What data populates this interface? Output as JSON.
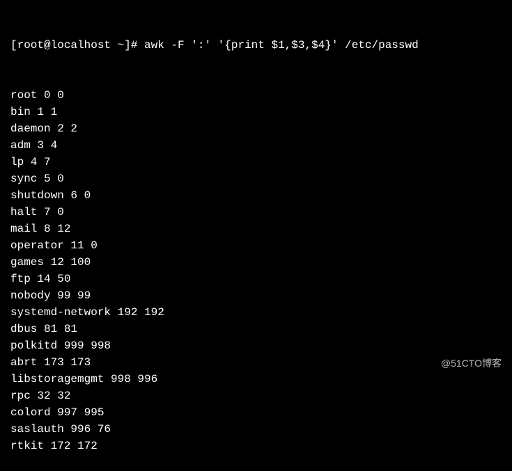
{
  "prompt": {
    "user_host": "[root@localhost ~]#",
    "command": "awk -F ':' '{print $1,$3,$4}' /etc/passwd"
  },
  "output_lines": [
    "root 0 0",
    "bin 1 1",
    "daemon 2 2",
    "adm 3 4",
    "lp 4 7",
    "sync 5 0",
    "shutdown 6 0",
    "halt 7 0",
    "mail 8 12",
    "operator 11 0",
    "games 12 100",
    "ftp 14 50",
    "nobody 99 99",
    "systemd-network 192 192",
    "dbus 81 81",
    "polkitd 999 998",
    "abrt 173 173",
    "libstoragemgmt 998 996",
    "rpc 32 32",
    "colord 997 995",
    "saslauth 996 76",
    "rtkit 172 172"
  ],
  "watermark": "@51CTO博客"
}
